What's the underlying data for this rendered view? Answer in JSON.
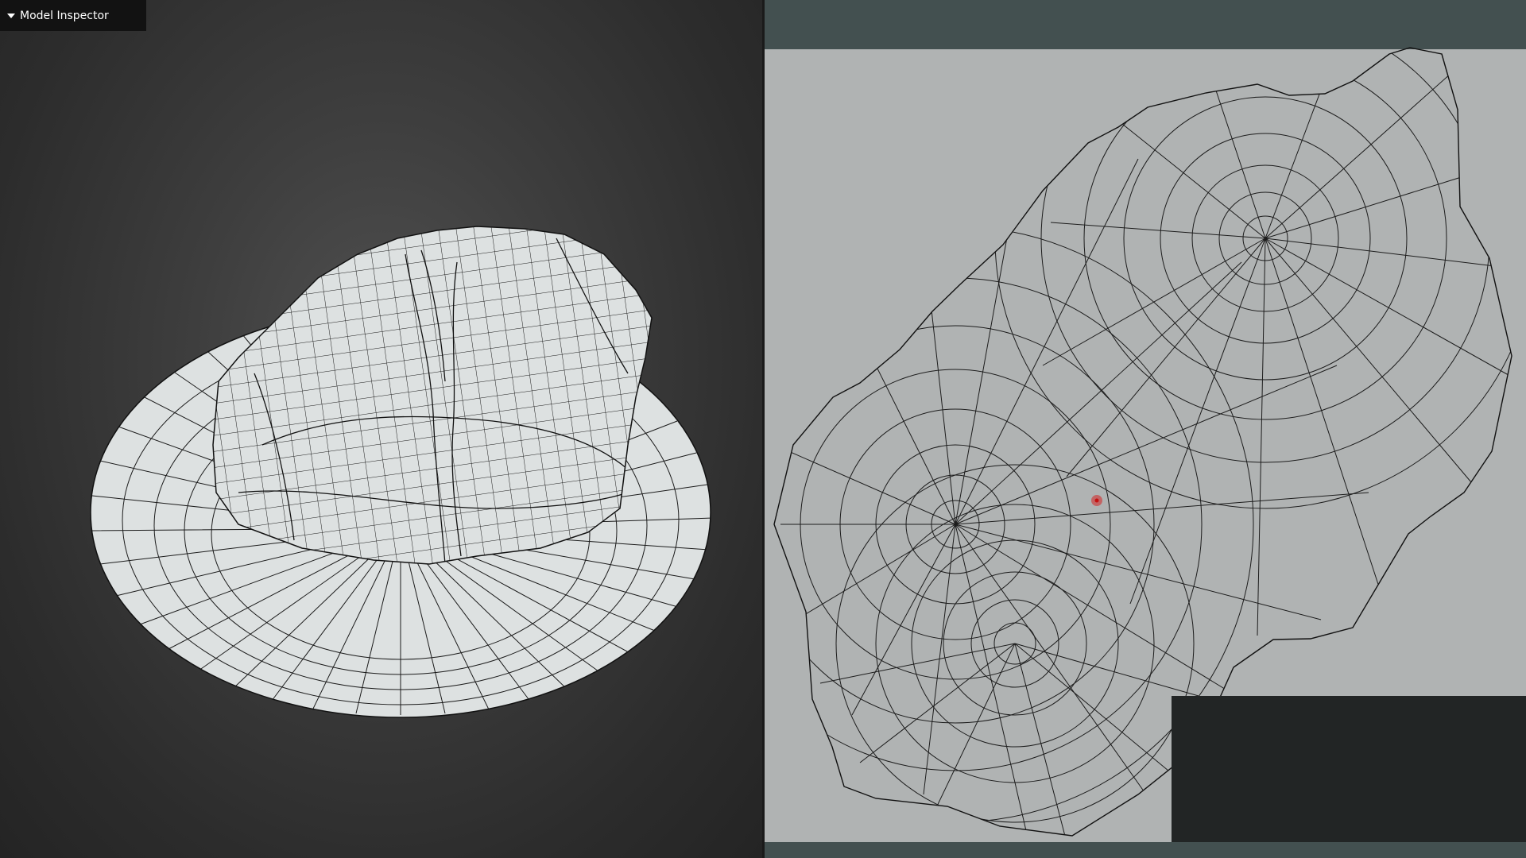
{
  "inspector": {
    "title": "Model Inspector",
    "toggle_icon": "triangle-down-icon"
  },
  "colors": {
    "viewport_bg": "#3e3e3e",
    "mesh_fill": "#dde1e1",
    "wire": "#151515",
    "uv_bg": "#b0b3b3",
    "uv_bar": "#435050",
    "cursor": "#d42020"
  }
}
